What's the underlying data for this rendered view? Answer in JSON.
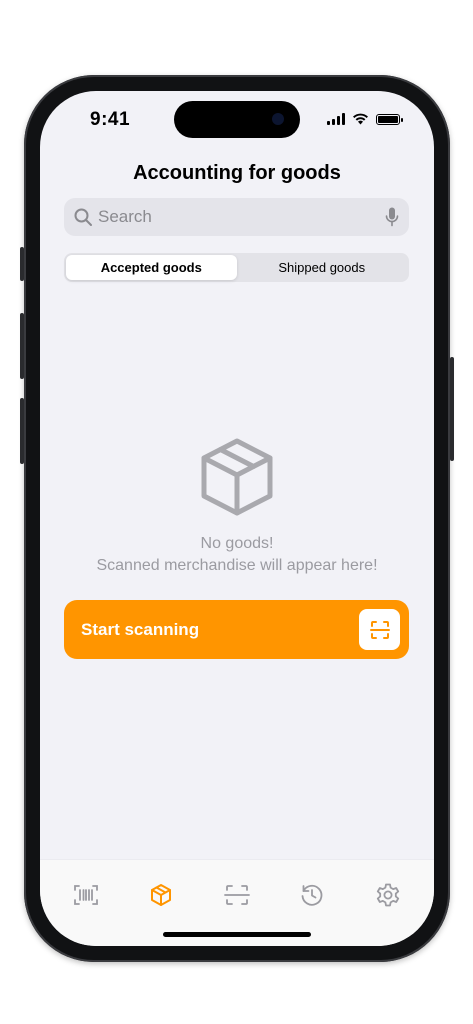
{
  "status_bar": {
    "time": "9:41",
    "icons": [
      "cellular-signal-icon",
      "wifi-icon",
      "battery-icon"
    ]
  },
  "header": {
    "title": "Accounting for goods"
  },
  "search": {
    "placeholder": "Search",
    "value": "",
    "icons": [
      "search-icon",
      "microphone-icon"
    ]
  },
  "segmented": {
    "options": [
      "Accepted goods",
      "Shipped goods"
    ],
    "selected": "Accepted goods"
  },
  "empty_state": {
    "icon": "box-icon",
    "title": "No goods!",
    "subtitle": "Scanned merchandise will appear here!"
  },
  "scan_button": {
    "label": "Start scanning",
    "icon": "scan-frame-icon"
  },
  "tab_bar": {
    "items": [
      {
        "icon": "barcode-icon",
        "active": false
      },
      {
        "icon": "package-icon",
        "active": true
      },
      {
        "icon": "scan-icon",
        "active": false
      },
      {
        "icon": "history-icon",
        "active": false
      },
      {
        "icon": "settings-gear-icon",
        "active": false
      }
    ]
  },
  "colors": {
    "accent": "#ff9500",
    "background": "#f2f2f7",
    "inactive_icon": "#9b9ba1",
    "device_frame": "#111214"
  }
}
